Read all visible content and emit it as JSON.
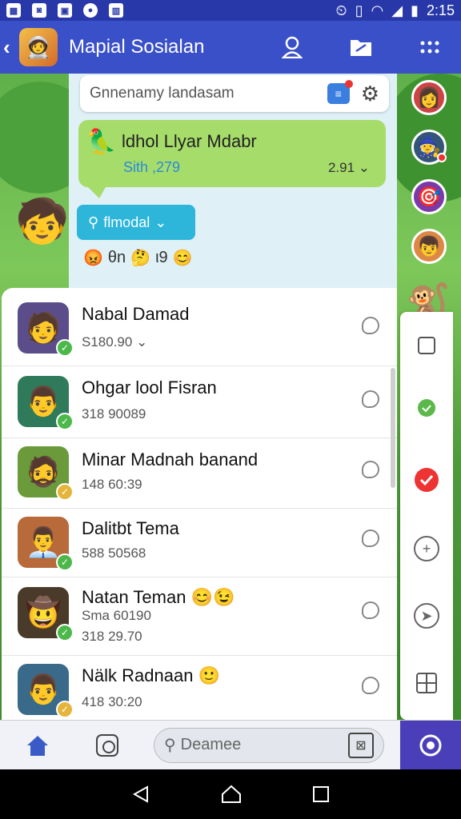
{
  "status_bar": {
    "time": "2:15"
  },
  "app_bar": {
    "title": "Mapial Sosialan"
  },
  "search": {
    "placeholder": "Gnnenamy landasam"
  },
  "message": {
    "title": "ldhol Llyar Mdabr",
    "subtitle": "Sith ,279",
    "time": "2.91"
  },
  "filter_button": {
    "label": "flmodal"
  },
  "emoji_row": {
    "text1": "θn",
    "text2": "ι9"
  },
  "contacts": [
    {
      "name": "Nabal Damad",
      "meta": "S180.90",
      "status": "green"
    },
    {
      "name": "Ohgar lool Fisran",
      "meta": "318 90089",
      "status": "green"
    },
    {
      "name": "Minar Madnah banand",
      "meta": "148 60:39",
      "status": "yellow"
    },
    {
      "name": "Dalitbt Tema",
      "meta": "588 50568",
      "status": "green"
    },
    {
      "name": "Natan Teman",
      "meta": "Sma 60190",
      "meta2": "318 29.70",
      "status": "green"
    },
    {
      "name": "Nälk Radnaan",
      "meta": "418 30:20",
      "status": "yellow"
    }
  ],
  "bottom_nav": {
    "search_placeholder": "Deamee"
  },
  "colors": {
    "app_bar": "#3a50c8",
    "status_bar": "#2838a8",
    "bubble": "#a6dc6a",
    "accent": "#2db6d9"
  }
}
